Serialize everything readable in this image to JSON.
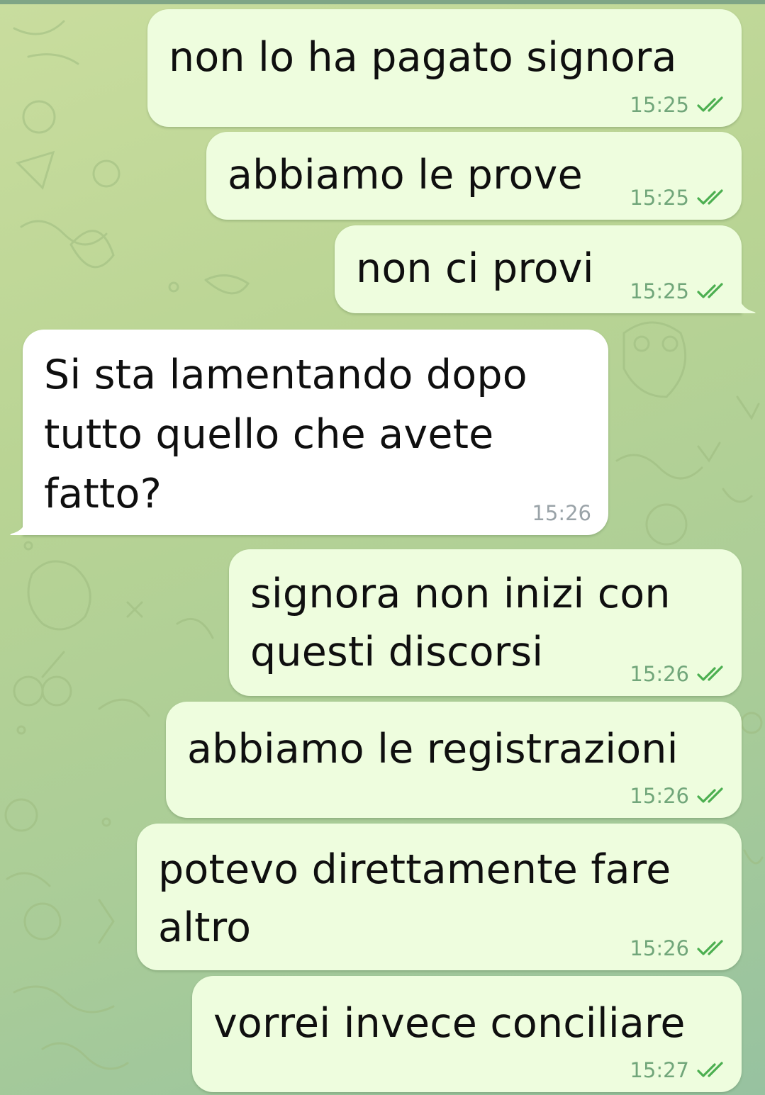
{
  "messages": [
    {
      "text": "non lo ha pagato signora",
      "time": "15:25",
      "direction": "outgoing",
      "status_icon": "double-check-icon"
    },
    {
      "text": "abbiamo le prove",
      "time": "15:25",
      "direction": "outgoing",
      "status_icon": "double-check-icon"
    },
    {
      "text": "non ci provi",
      "time": "15:25",
      "direction": "outgoing",
      "status_icon": "double-check-icon"
    },
    {
      "text": "Si sta lamentando dopo\ntutto quello che avete\nfatto?",
      "time": "15:26",
      "direction": "incoming"
    },
    {
      "text": "signora non inizi con\nquesti discorsi",
      "time": "15:26",
      "direction": "outgoing",
      "status_icon": "double-check-icon"
    },
    {
      "text": "abbiamo le registrazioni",
      "time": "15:26",
      "direction": "outgoing",
      "status_icon": "double-check-icon"
    },
    {
      "text": "potevo direttamente fare\naltro",
      "time": "15:26",
      "direction": "outgoing",
      "status_icon": "double-check-icon"
    },
    {
      "text": "vorrei invece conciliare",
      "time": "15:27",
      "direction": "outgoing",
      "status_icon": "double-check-icon"
    }
  ],
  "colors": {
    "outgoing_bubble": "#eefdde",
    "incoming_bubble": "#ffffff",
    "outgoing_time": "#71a67a",
    "incoming_time": "#9aa3a8",
    "check": "#4caf50"
  }
}
